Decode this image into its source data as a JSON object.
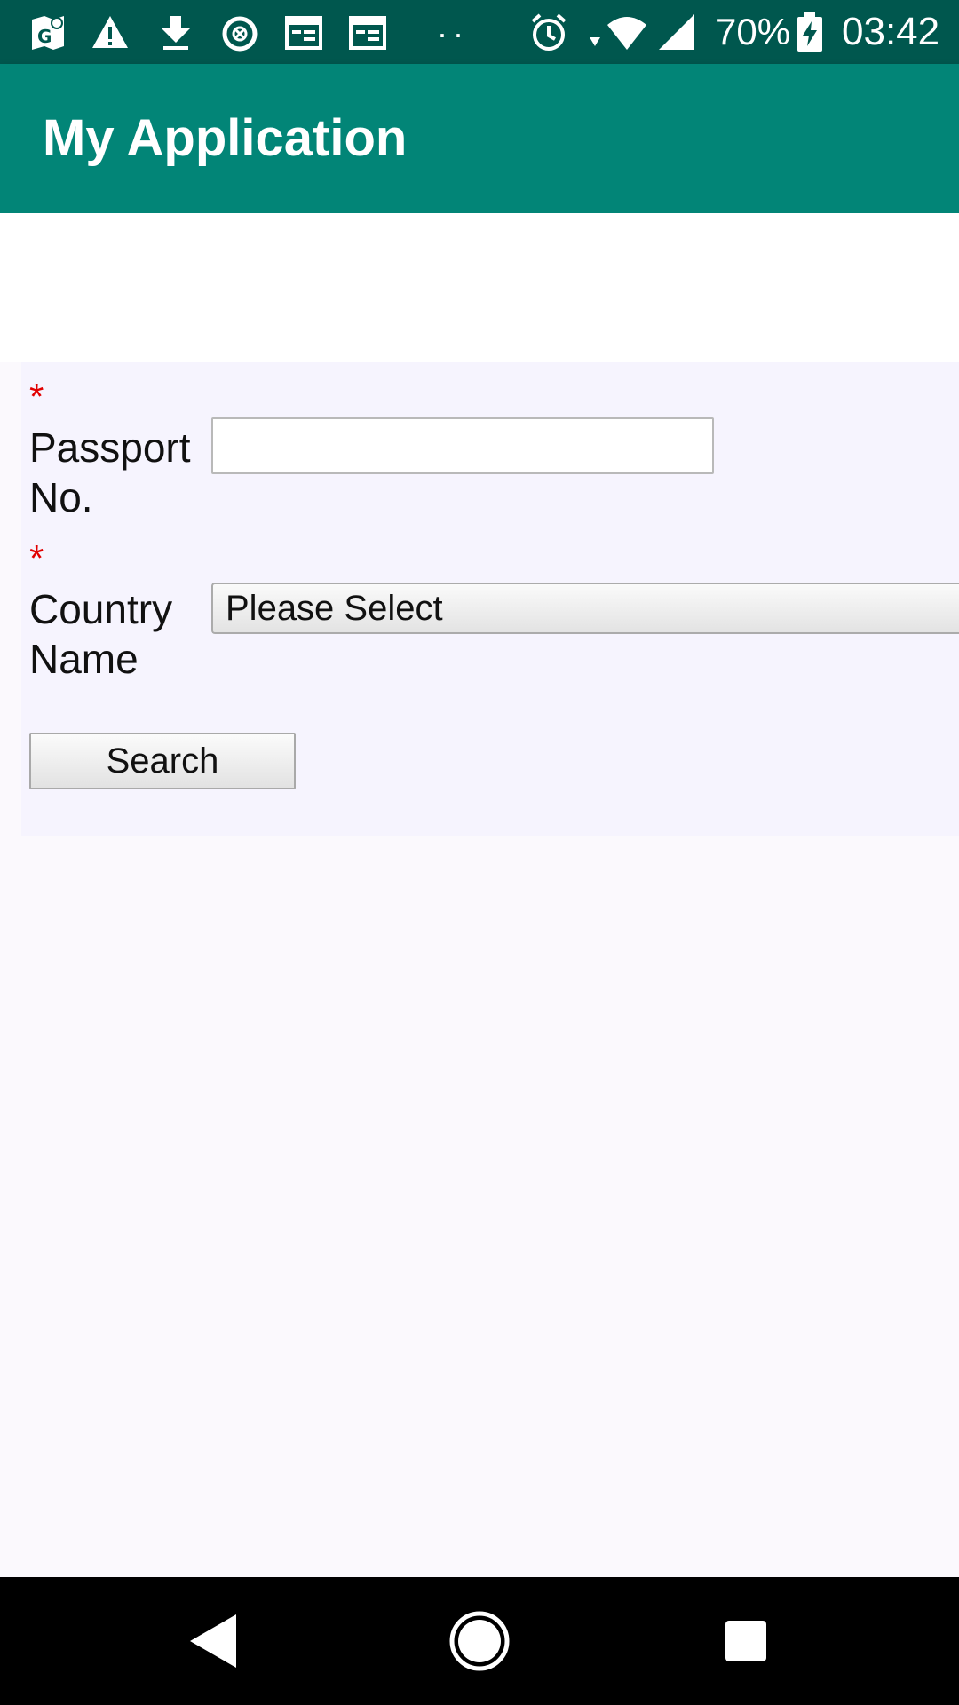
{
  "status_bar": {
    "left_icons": [
      "maps-icon",
      "warning-icon",
      "download-icon",
      "blocked-icon",
      "calendar-icon",
      "calendar-icon"
    ],
    "dots": "··",
    "right_icons": [
      "alarm-icon",
      "wifi-icon",
      "signal-icon",
      "battery-charging-icon"
    ],
    "battery": "70%",
    "time": "03:42"
  },
  "app_bar": {
    "title": "My Application",
    "color": "#028577"
  },
  "form": {
    "required_mark": "*",
    "passport": {
      "label_line1": "Passport",
      "label_line2": "No.",
      "value": "",
      "placeholder": ""
    },
    "country": {
      "label_line1": "Country",
      "label_line2": "Name",
      "selected": "Please Select"
    },
    "search_button": "Search"
  },
  "nav_bar": {
    "buttons": [
      "back-icon",
      "home-icon",
      "recents-icon"
    ]
  },
  "colors": {
    "status_bar": "#00574e",
    "required": "#e10000",
    "panel": "#f6f4fe"
  }
}
